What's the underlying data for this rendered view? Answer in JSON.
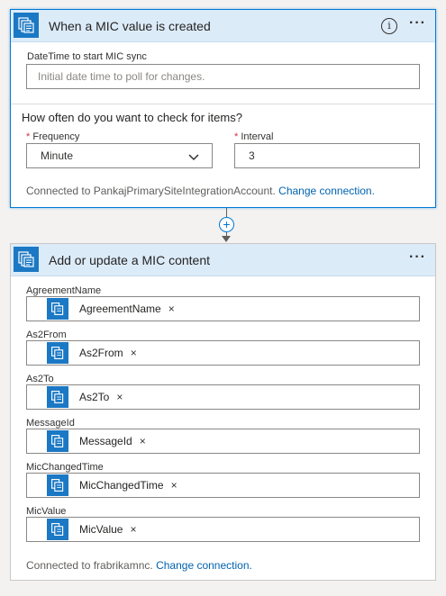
{
  "trigger": {
    "title": "When a MIC value is created",
    "datetime_label": "DateTime to start MIC sync",
    "datetime_placeholder": "Initial date time to poll for changes.",
    "question": "How often do you want to check for items?",
    "frequency_label": "Frequency",
    "frequency_value": "Minute",
    "interval_label": "Interval",
    "interval_value": "3",
    "required_mark": "*",
    "connected_text": "Connected to PankajPrimarySiteIntegrationAccount.",
    "change_connection": "Change connection."
  },
  "action": {
    "title": "Add or update a MIC content",
    "fields": [
      {
        "label": "AgreementName",
        "token": "AgreementName"
      },
      {
        "label": "As2From",
        "token": "As2From"
      },
      {
        "label": "As2To",
        "token": "As2To"
      },
      {
        "label": "MessageId",
        "token": "MessageId"
      },
      {
        "label": "MicChangedTime",
        "token": "MicChangedTime"
      },
      {
        "label": "MicValue",
        "token": "MicValue"
      }
    ],
    "remove_symbol": "×",
    "connected_text": "Connected to frabrikamnc.",
    "change_connection": "Change connection."
  },
  "icons": {
    "card_icon": "integration-account-icon",
    "info": "info-icon",
    "more": "more-options-icon",
    "add": "add-step-icon",
    "chevron": "chevron-down-icon"
  },
  "colors": {
    "accent": "#0078d4",
    "header_bg": "#dcebf8",
    "icon_bg": "#1b78c4",
    "link": "#0063b1"
  },
  "glyphs": {
    "info": "i",
    "more": "···",
    "plus": "+"
  }
}
